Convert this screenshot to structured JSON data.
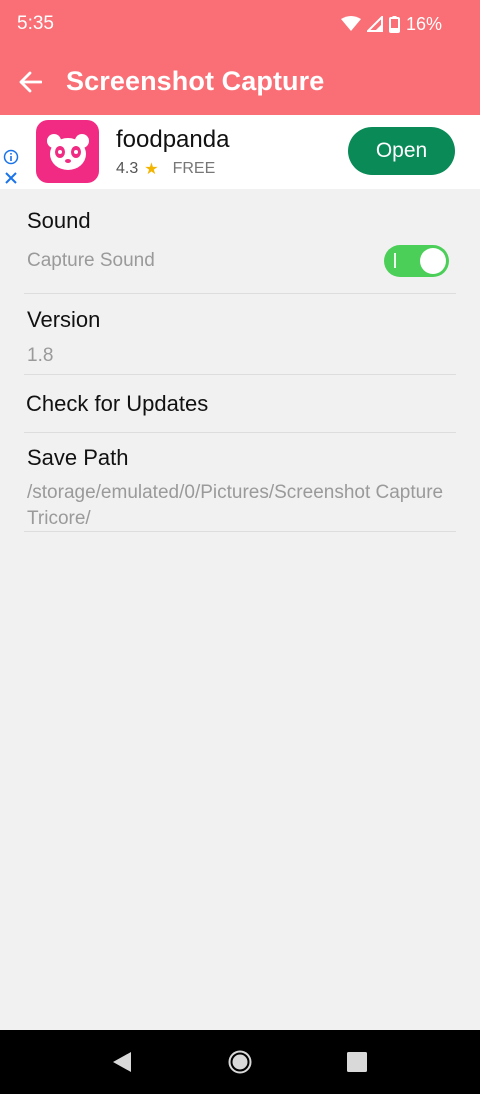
{
  "status_bar": {
    "time": "5:35",
    "battery": "16%"
  },
  "app_bar": {
    "title": "Screenshot Capture",
    "back_icon": "arrow-left-icon",
    "color": "#fa6f76"
  },
  "ad": {
    "app_name": "foodpanda",
    "rating": "4.3",
    "price": "FREE",
    "button_label": "Open",
    "button_color": "#0a8a57",
    "logo_color": "#f12b83"
  },
  "settings": {
    "sound": {
      "title": "Sound",
      "summary": "Capture Sound",
      "enabled": true
    },
    "version": {
      "title": "Version",
      "value": "1.8"
    },
    "check_updates": {
      "title": "Check for Updates"
    },
    "save_path": {
      "title": "Save Path",
      "value": "/storage/emulated/0/Pictures/Screenshot Capture Tricore/"
    }
  }
}
